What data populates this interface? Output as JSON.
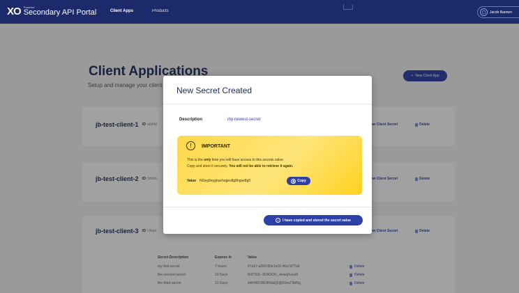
{
  "header": {
    "logo_mark": "XO",
    "logo_small": "Powered",
    "portal_title": "Secondary API Portal",
    "nav": [
      {
        "label": "Client Apps"
      },
      {
        "label": "Products"
      }
    ],
    "user_name": "Jacob Bannen"
  },
  "page": {
    "title": "Client Applications",
    "subtitle": "Setup and manage your client",
    "new_app_button": "New Client App",
    "id_label": "ID"
  },
  "clients": [
    {
      "name": "jb-test-client-1",
      "id": "abd4d",
      "new_secret_label": "New Client Secret",
      "delete_label": "Delete"
    },
    {
      "name": "jb-test-client-2",
      "id": "5bb8b",
      "new_secret_label": "New Client Secret",
      "delete_label": "Delete"
    },
    {
      "name": "jb-test-client-3",
      "id": "Ufbae",
      "new_secret_label": "New Client Secret",
      "delete_label": "Delete"
    }
  ],
  "secrets_table": {
    "headers": [
      "Secret Description",
      "Expires In",
      "Value"
    ],
    "rows": [
      {
        "description": "my-first-secret",
        "expires": "7 hours",
        "value": "47a97-a260-80e1e16-40a7d77a5",
        "delete": "Delete"
      },
      {
        "description": "the-second-secret",
        "expires": "10 Days",
        "value": "8r9TS|3--3U9GO0-_anwq0uuufd",
        "delete": "Delete"
      },
      {
        "description": "the-third-secret",
        "expires": "10 Days",
        "value": "zhR4RD9B3RNaQ0@00eu73bf5g",
        "delete": "Delete"
      }
    ]
  },
  "modal": {
    "title": "New Secret Created",
    "description_label": "Description",
    "description_value": "my-newest-secret",
    "important": {
      "title": "IMPORTANT",
      "line1_pre": "This is the ",
      "line1_bold": "only",
      "line1_post": " time you will have access to this secrets value.",
      "line2_pre": "Copy and store it securely. ",
      "line2_bold": "You will not be able to retrieve it again.",
      "value_label": "Value",
      "value": "NGeg9eyghsehoges8g8hgse8g0",
      "copy_label": "Copy"
    },
    "confirm_button": "I have copied and stored the secret value"
  },
  "colors": {
    "nav_bg": "#1c2a6b",
    "primary": "#2e3fa7",
    "title_text": "#1e2a5a",
    "warning_bg": "#ffd84a"
  }
}
